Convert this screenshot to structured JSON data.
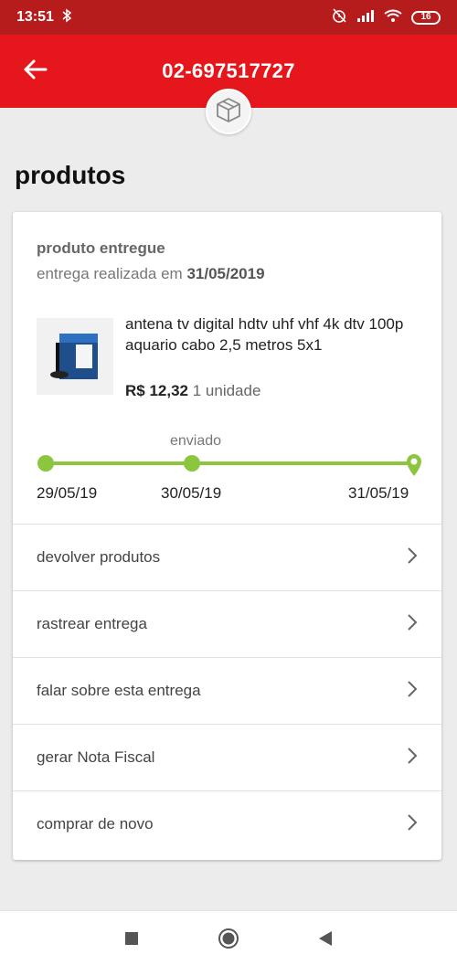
{
  "status_bar": {
    "time": "13:51",
    "battery": "16"
  },
  "header": {
    "title": "02-697517727"
  },
  "section": {
    "title": "produtos"
  },
  "delivery": {
    "status": "produto entregue",
    "date_prefix": "entrega realizada em ",
    "date": "31/05/2019"
  },
  "product": {
    "name": "antena tv digital hdtv uhf vhf 4k dtv 100p aquario cabo 2,5 metros 5x1",
    "price": "R$ 12,32",
    "quantity": "1 unidade"
  },
  "timeline": {
    "mid_label": "enviado",
    "dates": [
      "29/05/19",
      "30/05/19",
      "31/05/19"
    ],
    "color": "#8cc63f"
  },
  "menu": {
    "items": [
      {
        "label": "devolver produtos"
      },
      {
        "label": "rastrear entrega"
      },
      {
        "label": "falar sobre esta entrega"
      },
      {
        "label": "gerar Nota Fiscal"
      },
      {
        "label": "comprar de novo"
      }
    ]
  },
  "colors": {
    "brand": "#e5171c",
    "status_bar": "#b71c1c"
  },
  "icons": [
    "bluetooth-icon",
    "alarm-off-icon",
    "signal-icon",
    "wifi-icon",
    "battery-icon",
    "back-arrow-icon",
    "box-icon",
    "location-pin-icon",
    "chevron-right-icon",
    "nav-recents-icon",
    "nav-home-icon",
    "nav-back-icon"
  ]
}
